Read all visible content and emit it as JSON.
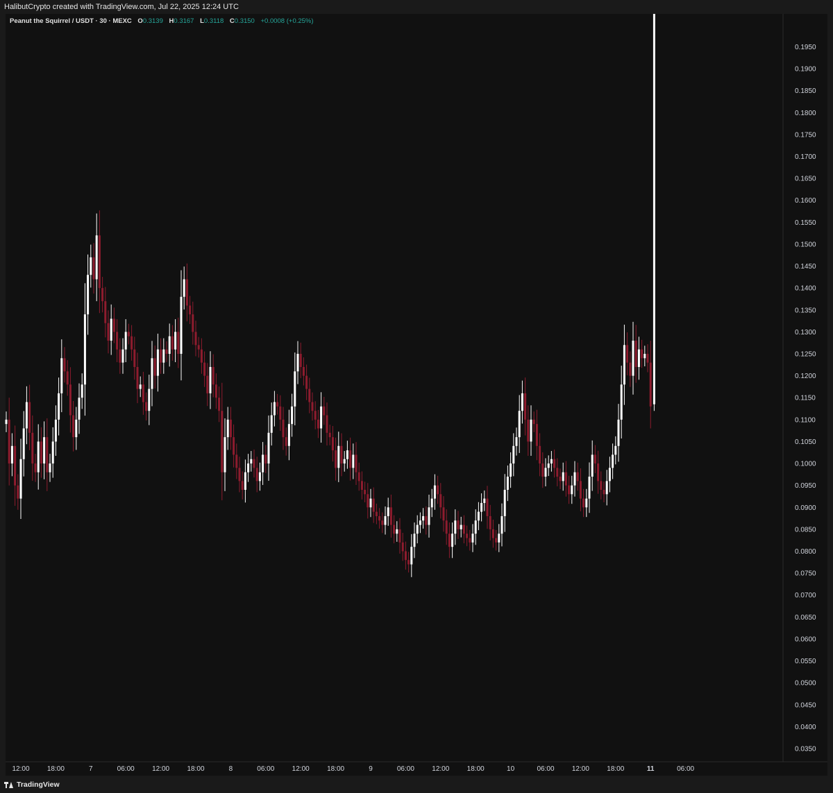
{
  "caption": "HalibutCrypto created with TradingView.com, Jul 22, 2025 12:24 UTC",
  "legend": {
    "symbol": "Peanut the Squirrel / USDT · 30 · MEXC",
    "o_label": "O",
    "o_value": "0.3139",
    "h_label": "H",
    "h_value": "0.3167",
    "l_label": "L",
    "l_value": "0.3118",
    "c_label": "C",
    "c_value": "0.3150",
    "change": "+0.0008 (+0.25%)"
  },
  "branding": {
    "logo_text": "TradingView"
  },
  "colors": {
    "up": "#ffffff",
    "down": "#8e1c2e",
    "background": "#111111",
    "text": "#d1d4dc",
    "legend_value": "#26a69a"
  },
  "chart_data": {
    "type": "candlestick",
    "timeframe": "30",
    "exchange": "MEXC",
    "ylim": [
      0.032,
      0.2025
    ],
    "grid": false,
    "y_ticks": [
      "0.1950",
      "0.1900",
      "0.1850",
      "0.1800",
      "0.1750",
      "0.1700",
      "0.1650",
      "0.1600",
      "0.1550",
      "0.1500",
      "0.1450",
      "0.1400",
      "0.1350",
      "0.1300",
      "0.1250",
      "0.1200",
      "0.1150",
      "0.1100",
      "0.1050",
      "0.1000",
      "0.0950",
      "0.0900",
      "0.0850",
      "0.0800",
      "0.0750",
      "0.0700",
      "0.0650",
      "0.0600",
      "0.0550",
      "0.0500",
      "0.0450",
      "0.0400",
      "0.0350"
    ],
    "x_ticks": [
      {
        "label": "12:00",
        "index": 5,
        "bold": false
      },
      {
        "label": "18:00",
        "index": 17,
        "bold": false
      },
      {
        "label": "7",
        "index": 29,
        "bold": false
      },
      {
        "label": "06:00",
        "index": 41,
        "bold": false
      },
      {
        "label": "12:00",
        "index": 53,
        "bold": false
      },
      {
        "label": "18:00",
        "index": 65,
        "bold": false
      },
      {
        "label": "8",
        "index": 77,
        "bold": false
      },
      {
        "label": "06:00",
        "index": 89,
        "bold": false
      },
      {
        "label": "12:00",
        "index": 101,
        "bold": false
      },
      {
        "label": "18:00",
        "index": 113,
        "bold": false
      },
      {
        "label": "9",
        "index": 125,
        "bold": false
      },
      {
        "label": "06:00",
        "index": 137,
        "bold": false
      },
      {
        "label": "12:00",
        "index": 149,
        "bold": false
      },
      {
        "label": "18:00",
        "index": 161,
        "bold": false
      },
      {
        "label": "10",
        "index": 173,
        "bold": false
      },
      {
        "label": "06:00",
        "index": 185,
        "bold": false
      },
      {
        "label": "12:00",
        "index": 197,
        "bold": false
      },
      {
        "label": "18:00",
        "index": 209,
        "bold": false
      },
      {
        "label": "11",
        "index": 221,
        "bold": true
      },
      {
        "label": "06:00",
        "index": 233,
        "bold": false
      }
    ],
    "closes": [
      0.11,
      0.1,
      0.104,
      0.095,
      0.092,
      0.101,
      0.108,
      0.114,
      0.107,
      0.1,
      0.098,
      0.105,
      0.1,
      0.106,
      0.098,
      0.1,
      0.105,
      0.11,
      0.116,
      0.124,
      0.121,
      0.118,
      0.111,
      0.106,
      0.11,
      0.115,
      0.118,
      0.134,
      0.143,
      0.147,
      0.142,
      0.152,
      0.14,
      0.137,
      0.132,
      0.128,
      0.133,
      0.13,
      0.126,
      0.123,
      0.126,
      0.13,
      0.129,
      0.126,
      0.122,
      0.117,
      0.118,
      0.114,
      0.112,
      0.117,
      0.124,
      0.12,
      0.126,
      0.123,
      0.126,
      0.125,
      0.129,
      0.126,
      0.13,
      0.125,
      0.138,
      0.142,
      0.136,
      0.134,
      0.13,
      0.127,
      0.126,
      0.123,
      0.12,
      0.116,
      0.122,
      0.118,
      0.115,
      0.112,
      0.098,
      0.106,
      0.11,
      0.106,
      0.102,
      0.099,
      0.096,
      0.094,
      0.098,
      0.1,
      0.101,
      0.099,
      0.096,
      0.098,
      0.102,
      0.1,
      0.107,
      0.111,
      0.114,
      0.113,
      0.11,
      0.106,
      0.104,
      0.109,
      0.113,
      0.121,
      0.125,
      0.122,
      0.12,
      0.117,
      0.114,
      0.112,
      0.11,
      0.108,
      0.113,
      0.111,
      0.107,
      0.106,
      0.103,
      0.099,
      0.104,
      0.1,
      0.101,
      0.103,
      0.099,
      0.102,
      0.098,
      0.096,
      0.094,
      0.093,
      0.09,
      0.092,
      0.089,
      0.088,
      0.087,
      0.086,
      0.088,
      0.09,
      0.086,
      0.084,
      0.085,
      0.082,
      0.08,
      0.078,
      0.077,
      0.081,
      0.084,
      0.086,
      0.087,
      0.088,
      0.086,
      0.09,
      0.092,
      0.095,
      0.093,
      0.09,
      0.087,
      0.084,
      0.081,
      0.084,
      0.087,
      0.085,
      0.086,
      0.084,
      0.083,
      0.082,
      0.084,
      0.087,
      0.089,
      0.091,
      0.092,
      0.088,
      0.085,
      0.083,
      0.082,
      0.084,
      0.088,
      0.094,
      0.097,
      0.1,
      0.104,
      0.106,
      0.112,
      0.116,
      0.11,
      0.105,
      0.11,
      0.109,
      0.104,
      0.1,
      0.097,
      0.099,
      0.1,
      0.101,
      0.099,
      0.097,
      0.096,
      0.098,
      0.095,
      0.093,
      0.095,
      0.098,
      0.096,
      0.092,
      0.09,
      0.092,
      0.097,
      0.102,
      0.1,
      0.096,
      0.094,
      0.093,
      0.096,
      0.099,
      0.102,
      0.104,
      0.11,
      0.118,
      0.127,
      0.123,
      0.12,
      0.128,
      0.122,
      0.126,
      0.124,
      0.125,
      0.123,
      0.113
    ]
  }
}
